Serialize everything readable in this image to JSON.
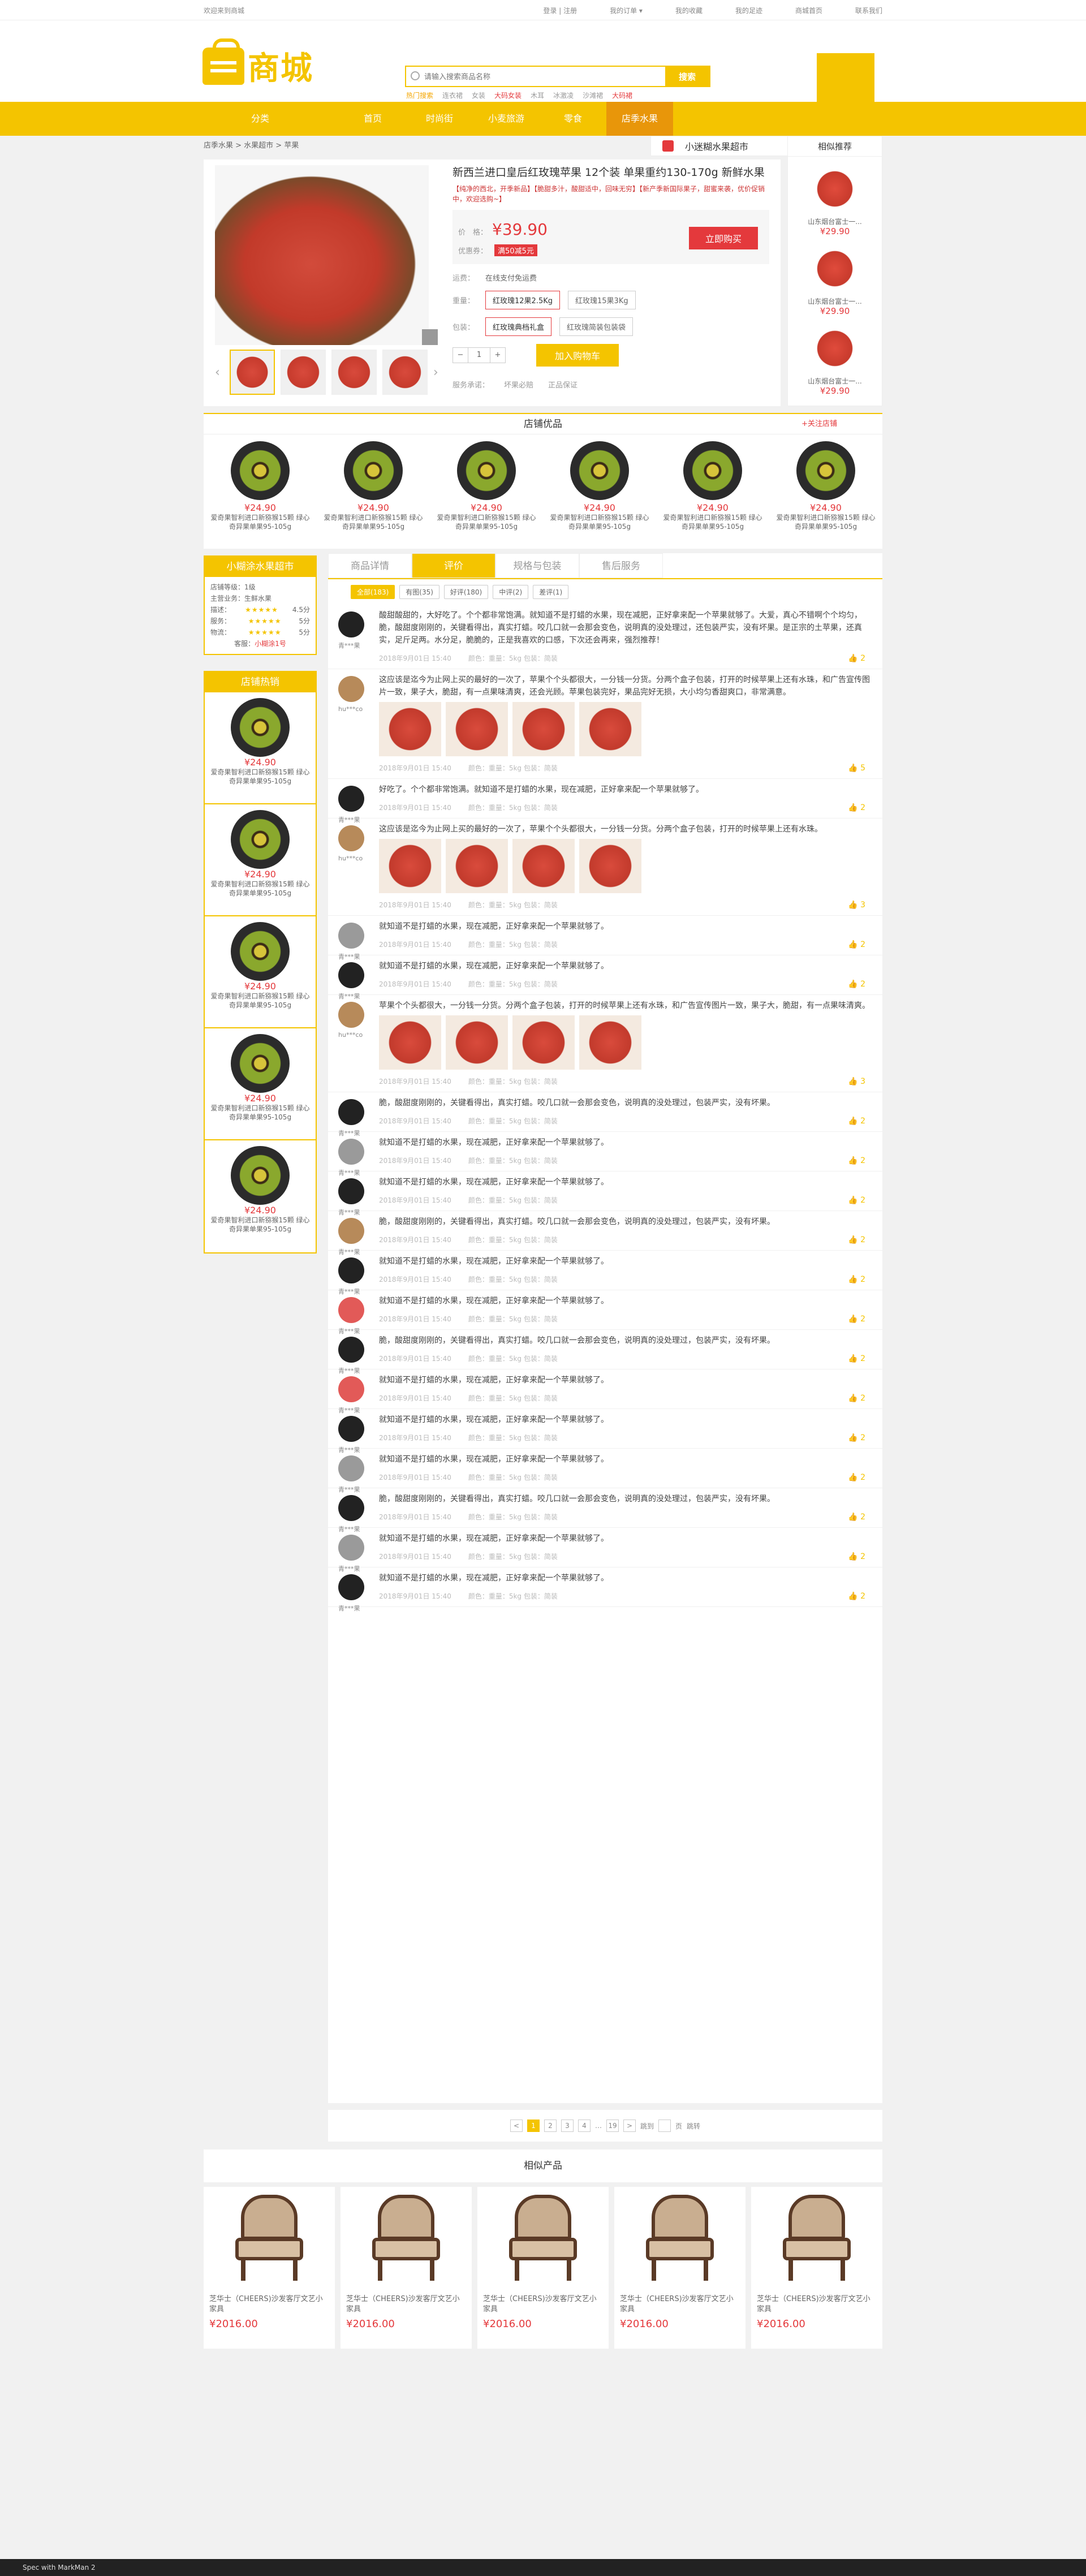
{
  "topbar": {
    "welcome": "欢迎来到商城",
    "links": [
      "登录 | 注册",
      "我的订单 ▾",
      "我的收藏",
      "我的足迹",
      "商城首页",
      "联系我们"
    ]
  },
  "header": {
    "logo_text": "商城",
    "search_placeholder": "请输入搜索商品名称",
    "search_button": "搜索",
    "hot_words": [
      "热门搜索",
      "连衣裙",
      "女装",
      "大码女装",
      "木耳",
      "冰激凌",
      "沙滩裙",
      "大码裙"
    ]
  },
  "nav": {
    "all": "分类",
    "items": [
      "首页",
      "时尚街",
      "小麦旅游",
      "零食",
      "店季水果"
    ],
    "active_index": 4
  },
  "breadcrumb": "店季水果 > 水果超市 > 苹果",
  "shop_tag": "小迷糊水果超市",
  "product": {
    "title": "新西兰进口皇后红玫瑰苹果 12个装 单果重约130-170g 新鲜水果",
    "subtitle": "【纯净的西北，开季新品】【脆甜多汁，酸甜适中，回味无穷】【新产季新国际果子，甜蜜来袭，优价促销中，欢迎选购~】",
    "price_label": "价　格：",
    "price": "¥39.90",
    "coupon_label": "优惠券：",
    "coupon": "满50减5元",
    "buy": "立即购买",
    "ship_label": "运费：",
    "ship": "在线支付免运费",
    "weight_label": "重量：",
    "weights": [
      "红玫瑰12果2.5Kg",
      "红玫瑰15果3Kg"
    ],
    "pack_label": "包装：",
    "packs": [
      "红玫瑰典档礼盒",
      "红玫瑰简装包装袋"
    ],
    "qty": "1",
    "add_cart": "加入购物车",
    "service_label": "服务承诺：",
    "services": [
      "坏果必赔",
      "正品保证"
    ]
  },
  "similar": {
    "title": "相似推荐",
    "items": [
      {
        "name": "山东烟台富士一...",
        "price": "¥29.90"
      },
      {
        "name": "山东烟台富士一...",
        "price": "¥29.90"
      },
      {
        "name": "山东烟台富士一...",
        "price": "¥29.90"
      }
    ]
  },
  "best": {
    "title": "店铺优品",
    "follow": "+关注店铺",
    "items": [
      {
        "price": "¥24.90",
        "desc": "爱奇果智利进口新猕猴15颗 绿心奇异果单果95-105g"
      },
      {
        "price": "¥24.90",
        "desc": "爱奇果智利进口新猕猴15颗 绿心奇异果单果95-105g"
      },
      {
        "price": "¥24.90",
        "desc": "爱奇果智利进口新猕猴15颗 绿心奇异果单果95-105g"
      },
      {
        "price": "¥24.90",
        "desc": "爱奇果智利进口新猕猴15颗 绿心奇异果单果95-105g"
      },
      {
        "price": "¥24.90",
        "desc": "爱奇果智利进口新猕猴15颗 绿心奇异果单果95-105g"
      },
      {
        "price": "¥24.90",
        "desc": "爱奇果智利进口新猕猴15颗 绿心奇异果单果95-105g"
      }
    ]
  },
  "shopcard": {
    "title": "小糊涂水果超市",
    "level_k": "店铺等级：",
    "level_v": "1级",
    "hall_k": "主营业务：",
    "hall_v": "生鲜水果",
    "r1_k": "描述：",
    "r1_v": "4.5分",
    "r2_k": "服务：",
    "r2_v": "5分",
    "r3_k": "物流：",
    "r3_v": "5分",
    "contact_k": "客服：",
    "contact_v": "小糊涂1号",
    "stars": "★★★★★"
  },
  "rank": {
    "title": "店铺热销",
    "items": [
      {
        "price": "¥24.90",
        "desc": "爱奇果智利进口新猕猴15颗 绿心奇异果单果95-105g"
      },
      {
        "price": "¥24.90",
        "desc": "爱奇果智利进口新猕猴15颗 绿心奇异果单果95-105g"
      },
      {
        "price": "¥24.90",
        "desc": "爱奇果智利进口新猕猴15颗 绿心奇异果单果95-105g"
      },
      {
        "price": "¥24.90",
        "desc": "爱奇果智利进口新猕猴15颗 绿心奇异果单果95-105g"
      },
      {
        "price": "¥24.90",
        "desc": "爱奇果智利进口新猕猴15颗 绿心奇异果单果95-105g"
      }
    ]
  },
  "tabs": [
    "商品详情",
    "评价",
    "规格与包装",
    "售后服务"
  ],
  "filters": [
    "全部(183)",
    "有图(35)",
    "好评(180)",
    "中评(2)",
    "差评(1)"
  ],
  "reviews": [
    {
      "user": "青***果",
      "text": "酸甜酸甜的，大好吃了。个个都非常饱满。就知道不是打蜡的水果，现在减肥，正好拿来配一个苹果就够了。大爱，真心不错啊个个均匀，脆，酸甜度刚刚的，关键看得出，真实打蜡。咬几口就一会那会变色，说明真的没处理过，还包装严实，没有坏果。是正宗的土苹果，还真实，足斤足两。水分足，脆脆的，正是我喜欢的口感，下次还会再来，强烈推荐！",
      "date": "2018年9月01日 15:40",
      "spec": "颜色：重量：5kg  包装：简装",
      "likes": "2",
      "av": "a",
      "pics": 0
    },
    {
      "user": "hu***co",
      "text": "这应该是迄今为止网上买的最好的一次了，苹果个个头都很大，一分钱一分货。分两个盒子包装，打开的时候苹果上还有水珠，和广告宣传图片一致，果子大，脆甜，有一点果味清爽，还会光顾。苹果包装完好，果品完好无损，大小均匀香甜爽口，非常满意。",
      "date": "2018年9月01日 15:40",
      "spec": "颜色：重量：5kg  包装：简装",
      "likes": "5",
      "av": "b",
      "pics": 4
    },
    {
      "user": "青***果",
      "text": "好吃了。个个都非常饱满。就知道不是打蜡的水果，现在减肥，正好拿来配一个苹果就够了。",
      "date": "2018年9月01日 15:40",
      "spec": "颜色：重量：5kg  包装：简装",
      "likes": "2",
      "av": "a",
      "pics": 0
    },
    {
      "user": "hu***co",
      "text": "这应该是迄今为止网上买的最好的一次了，苹果个个头都很大，一分钱一分货。分两个盒子包装，打开的时候苹果上还有水珠。",
      "date": "2018年9月01日 15:40",
      "spec": "颜色：重量：5kg  包装：简装",
      "likes": "3",
      "av": "b",
      "pics": 4
    },
    {
      "user": "青***果",
      "text": "就知道不是打蜡的水果，现在减肥，正好拿来配一个苹果就够了。",
      "date": "2018年9月01日 15:40",
      "spec": "颜色：重量：5kg  包装：简装",
      "likes": "2",
      "av": "d",
      "pics": 0
    },
    {
      "user": "青***果",
      "text": "就知道不是打蜡的水果，现在减肥，正好拿来配一个苹果就够了。",
      "date": "2018年9月01日 15:40",
      "spec": "颜色：重量：5kg  包装：简装",
      "likes": "2",
      "av": "a",
      "pics": 0
    },
    {
      "user": "hu***co",
      "text": "苹果个个头都很大，一分钱一分货。分两个盒子包装，打开的时候苹果上还有水珠，和广告宣传图片一致，果子大，脆甜，有一点果味清爽。",
      "date": "2018年9月01日 15:40",
      "spec": "颜色：重量：5kg  包装：简装",
      "likes": "3",
      "av": "b",
      "pics": 4
    },
    {
      "user": "青***果",
      "text": "脆，酸甜度刚刚的，关键看得出，真实打蜡。咬几口就一会那会变色，说明真的没处理过，包装严实，没有坏果。",
      "date": "2018年9月01日 15:40",
      "spec": "颜色：重量：5kg  包装：简装",
      "likes": "2",
      "av": "a",
      "pics": 0
    },
    {
      "user": "青***果",
      "text": "就知道不是打蜡的水果，现在减肥，正好拿来配一个苹果就够了。",
      "date": "2018年9月01日 15:40",
      "spec": "颜色：重量：5kg  包装：简装",
      "likes": "2",
      "av": "d",
      "pics": 0
    },
    {
      "user": "青***果",
      "text": "就知道不是打蜡的水果，现在减肥，正好拿来配一个苹果就够了。",
      "date": "2018年9月01日 15:40",
      "spec": "颜色：重量：5kg  包装：简装",
      "likes": "2",
      "av": "a",
      "pics": 0
    },
    {
      "user": "青***果",
      "text": "脆，酸甜度刚刚的，关键看得出，真实打蜡。咬几口就一会那会变色，说明真的没处理过，包装严实，没有坏果。",
      "date": "2018年9月01日 15:40",
      "spec": "颜色：重量：5kg  包装：简装",
      "likes": "2",
      "av": "b",
      "pics": 0
    },
    {
      "user": "青***果",
      "text": "就知道不是打蜡的水果，现在减肥，正好拿来配一个苹果就够了。",
      "date": "2018年9月01日 15:40",
      "spec": "颜色：重量：5kg  包装：简装",
      "likes": "2",
      "av": "a",
      "pics": 0
    },
    {
      "user": "青***果",
      "text": "就知道不是打蜡的水果，现在减肥，正好拿来配一个苹果就够了。",
      "date": "2018年9月01日 15:40",
      "spec": "颜色：重量：5kg  包装：简装",
      "likes": "2",
      "av": "c",
      "pics": 0
    },
    {
      "user": "青***果",
      "text": "脆，酸甜度刚刚的，关键看得出，真实打蜡。咬几口就一会那会变色，说明真的没处理过，包装严实，没有坏果。",
      "date": "2018年9月01日 15:40",
      "spec": "颜色：重量：5kg  包装：简装",
      "likes": "2",
      "av": "a",
      "pics": 0
    },
    {
      "user": "青***果",
      "text": "就知道不是打蜡的水果，现在减肥，正好拿来配一个苹果就够了。",
      "date": "2018年9月01日 15:40",
      "spec": "颜色：重量：5kg  包装：简装",
      "likes": "2",
      "av": "c",
      "pics": 0
    },
    {
      "user": "青***果",
      "text": "就知道不是打蜡的水果，现在减肥，正好拿来配一个苹果就够了。",
      "date": "2018年9月01日 15:40",
      "spec": "颜色：重量：5kg  包装：简装",
      "likes": "2",
      "av": "a",
      "pics": 0
    },
    {
      "user": "青***果",
      "text": "就知道不是打蜡的水果，现在减肥，正好拿来配一个苹果就够了。",
      "date": "2018年9月01日 15:40",
      "spec": "颜色：重量：5kg  包装：简装",
      "likes": "2",
      "av": "d",
      "pics": 0
    },
    {
      "user": "青***果",
      "text": "脆，酸甜度刚刚的，关键看得出，真实打蜡。咬几口就一会那会变色，说明真的没处理过，包装严实，没有坏果。",
      "date": "2018年9月01日 15:40",
      "spec": "颜色：重量：5kg  包装：简装",
      "likes": "2",
      "av": "a",
      "pics": 0
    },
    {
      "user": "青***果",
      "text": "就知道不是打蜡的水果，现在减肥，正好拿来配一个苹果就够了。",
      "date": "2018年9月01日 15:40",
      "spec": "颜色：重量：5kg  包装：简装",
      "likes": "2",
      "av": "d",
      "pics": 0
    },
    {
      "user": "青***果",
      "text": "就知道不是打蜡的水果，现在减肥，正好拿来配一个苹果就够了。",
      "date": "2018年9月01日 15:40",
      "spec": "颜色：重量：5kg  包装：简装",
      "likes": "2",
      "av": "a",
      "pics": 0
    }
  ],
  "pager": {
    "prev": "<",
    "pages": [
      "1",
      "2",
      "3",
      "4",
      "…",
      "19"
    ],
    "next": ">",
    "goto": "跳到",
    "unit": "页",
    "confirm": "跳转"
  },
  "related": {
    "title": "相似产品",
    "items": [
      {
        "name": "芝华士（CHEERS)沙发客厅文艺小家具",
        "price": "¥2016.00"
      },
      {
        "name": "芝华士（CHEERS)沙发客厅文艺小家具",
        "price": "¥2016.00"
      },
      {
        "name": "芝华士（CHEERS)沙发客厅文艺小家具",
        "price": "¥2016.00"
      },
      {
        "name": "芝华士（CHEERS)沙发客厅文艺小家具",
        "price": "¥2016.00"
      },
      {
        "name": "芝华士（CHEERS)沙发客厅文艺小家具",
        "price": "¥2016.00"
      }
    ]
  },
  "footer": "Spec with MarkMan 2"
}
